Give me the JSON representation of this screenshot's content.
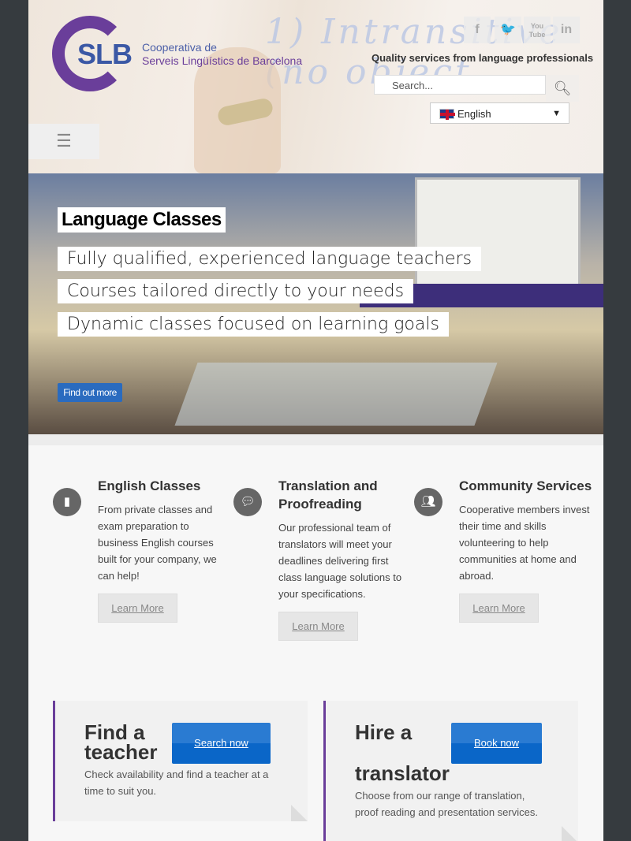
{
  "header": {
    "logo_abbr": "SLB",
    "logo_line1": "Cooperativa de",
    "logo_line2": "Serveis Lingüístics de Barcelona",
    "tagline": "Quality services from language professionals",
    "social": [
      {
        "icon": "facebook-icon",
        "label": "f"
      },
      {
        "icon": "twitter-icon",
        "label": "t"
      },
      {
        "icon": "youtube-icon",
        "label": "You Tube"
      },
      {
        "icon": "linkedin-icon",
        "label": "in"
      }
    ],
    "search_placeholder": "Search...",
    "language": "English"
  },
  "hero": {
    "title": "Language Classes",
    "lines": [
      "Fully qualified, experienced language teachers",
      "Courses tailored directly to your needs",
      "Dynamic classes focused on learning goals"
    ],
    "button": "Find out more"
  },
  "features": [
    {
      "icon": "book-icon",
      "title": "English Classes",
      "text": "From private classes and exam preparation to business English courses built for your company, we can help!",
      "button": "Learn More"
    },
    {
      "icon": "chat-icon",
      "title": "Translation and Proofreading",
      "text": "Our professional team of translators will meet your deadlines delivering first class language solutions to your specifications.",
      "button": "Learn More"
    },
    {
      "icon": "group-icon",
      "title": "Community Services",
      "text": "Cooperative members invest their time and skills volunteering to help communities at home and abroad.",
      "button": "Learn More"
    }
  ],
  "cta": [
    {
      "title_1": "Find a",
      "title_2": "teacher",
      "text": "Check availability and find a teacher at a time to suit you.",
      "button": "Search now"
    },
    {
      "title_1": "Hire a",
      "title_2": "translator",
      "text": "Choose from our range of translation, proof reading and presentation services.",
      "button": "Book now"
    }
  ],
  "colors": {
    "brand_purple": "#6a3e9a",
    "brand_blue": "#3b58a5",
    "button_blue": "#0a66c8",
    "sidebar_dark": "#363b3f"
  }
}
